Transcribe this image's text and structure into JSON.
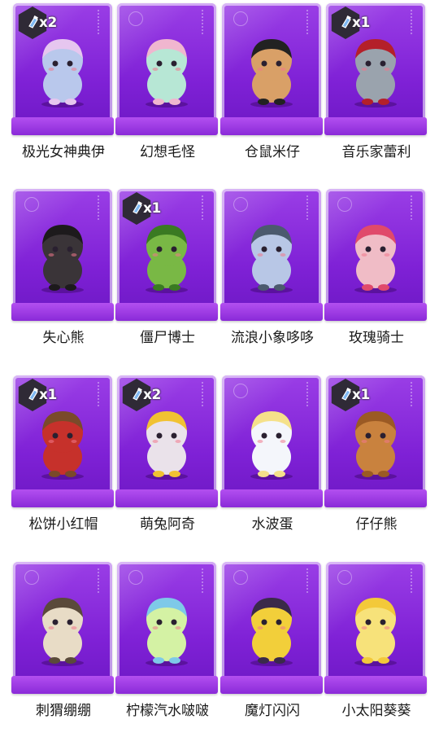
{
  "accent_color": "#8a2ad8",
  "items": [
    {
      "name": "极光女神典伊",
      "badge": "x2",
      "body": "#b9c8ec",
      "hair": "#e6c6ef",
      "icon": "figure-aurora"
    },
    {
      "name": "幻想毛怪",
      "badge": "",
      "body": "#b7e7d5",
      "hair": "#f0b6cf",
      "icon": "figure-fantasy-monster"
    },
    {
      "name": "仓鼠米仔",
      "badge": "",
      "body": "#d9a067",
      "hair": "#222222",
      "icon": "figure-hamster"
    },
    {
      "name": "音乐家蕾利",
      "badge": "x1",
      "body": "#9aa3ad",
      "hair": "#b4202a",
      "icon": "figure-musician"
    },
    {
      "name": "失心熊",
      "badge": "",
      "body": "#3a3438",
      "hair": "#1d1a1c",
      "icon": "figure-bear"
    },
    {
      "name": "僵尸博士",
      "badge": "x1",
      "body": "#79b845",
      "hair": "#3a7a22",
      "icon": "figure-zombie"
    },
    {
      "name": "流浪小象哆哆",
      "badge": "",
      "body": "#b8c7e6",
      "hair": "#4b5a6e",
      "icon": "figure-elephant"
    },
    {
      "name": "玫瑰骑士",
      "badge": "",
      "body": "#f0bcc6",
      "hair": "#e04a6b",
      "icon": "figure-rose-knight"
    },
    {
      "name": "松饼小红帽",
      "badge": "x1",
      "body": "#c6312b",
      "hair": "#7a4a2a",
      "icon": "figure-red-hood"
    },
    {
      "name": "萌兔阿奇",
      "badge": "x2",
      "body": "#eae2ea",
      "hair": "#f1c232",
      "icon": "figure-bunny"
    },
    {
      "name": "水波蛋",
      "badge": "",
      "body": "#f4f6fb",
      "hair": "#f5e18a",
      "icon": "figure-egg"
    },
    {
      "name": "仔仔熊",
      "badge": "x1",
      "body": "#c9823e",
      "hair": "#9b5a24",
      "icon": "figure-teddy"
    },
    {
      "name": "刺猬绷绷",
      "badge": "",
      "body": "#e8dcc6",
      "hair": "#5a4a3a",
      "icon": "figure-hedgehog"
    },
    {
      "name": "柠檬汽水啵啵",
      "badge": "",
      "body": "#d4f2a4",
      "hair": "#7ec9e8",
      "icon": "figure-lemon-soda"
    },
    {
      "name": "魔灯闪闪",
      "badge": "",
      "body": "#f2cf3a",
      "hair": "#3a2a4a",
      "icon": "figure-magic-lamp"
    },
    {
      "name": "小太阳葵葵",
      "badge": "",
      "body": "#f7e27a",
      "hair": "#f3c93a",
      "icon": "figure-sunflower"
    }
  ]
}
